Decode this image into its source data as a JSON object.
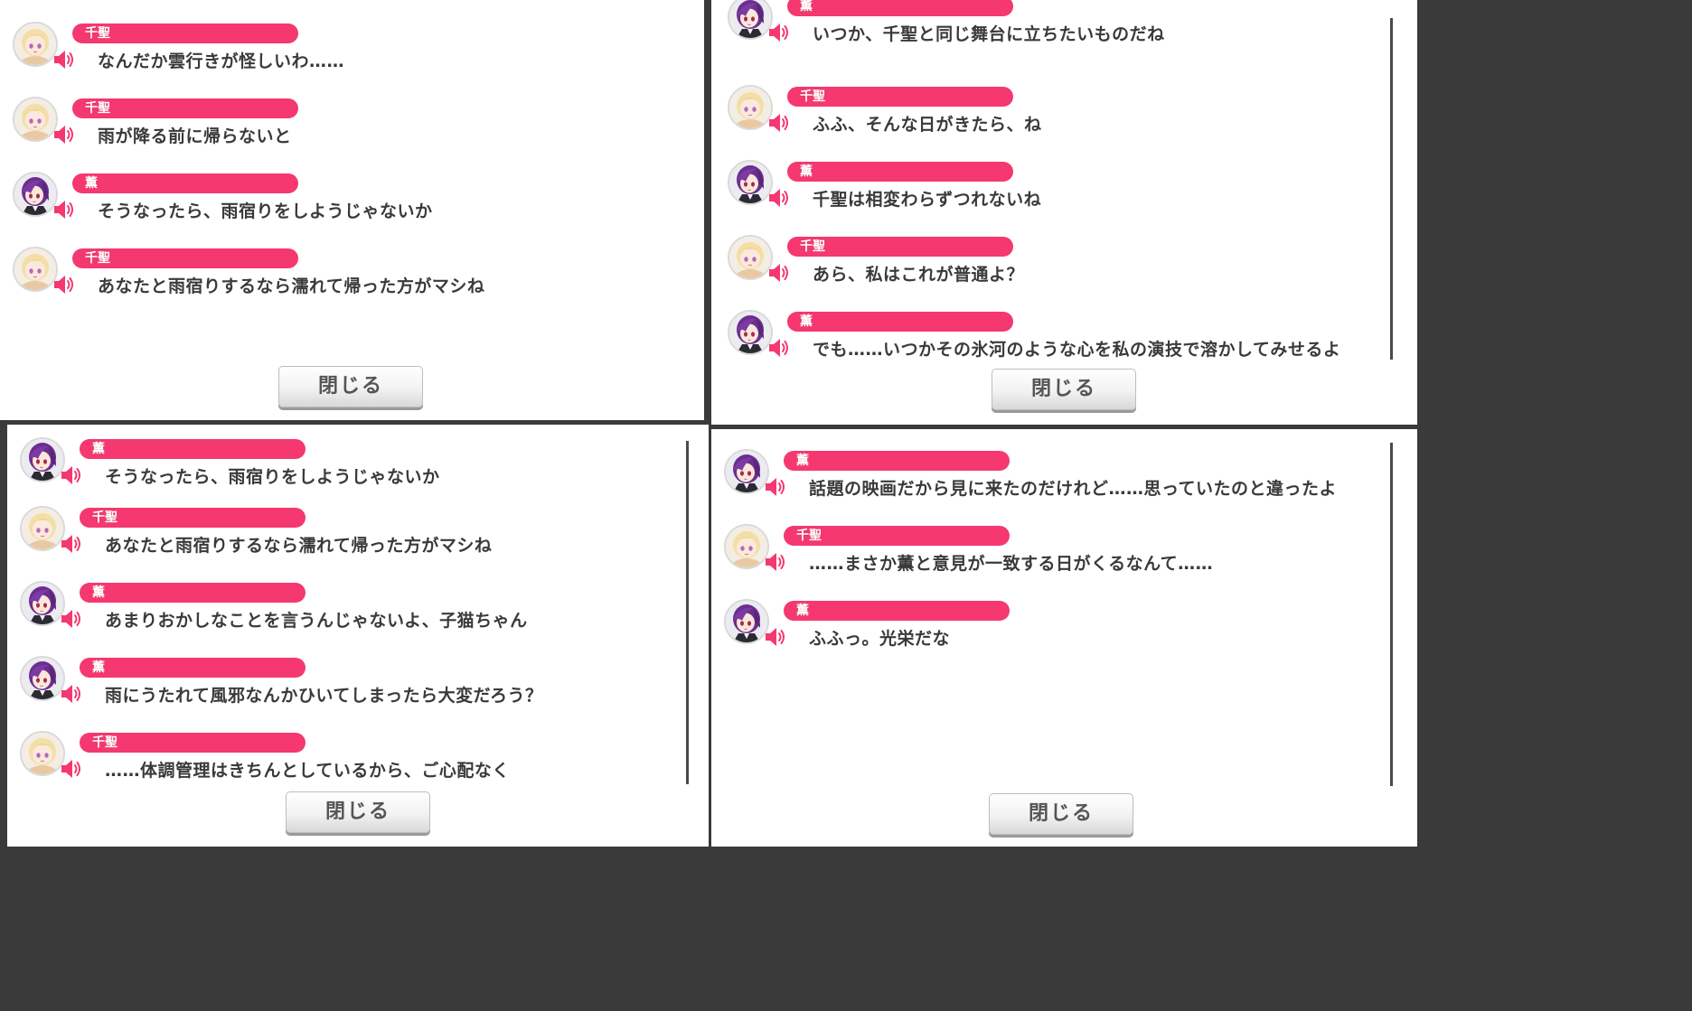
{
  "close_label": "閉じる",
  "colors": {
    "nameplate": "#f5386f",
    "speaker": "#f5386f"
  },
  "icons": {
    "speaker": "speaker-icon",
    "avatar_chisato": "chisato-avatar",
    "avatar_kaoru": "kaoru-avatar"
  },
  "panels": [
    {
      "entries": [
        {
          "name": "千聖",
          "text": "なんだか雲行きが怪しいわ……"
        },
        {
          "name": "千聖",
          "text": "雨が降る前に帰らないと"
        },
        {
          "name": "薫",
          "text": "そうなったら、雨宿りをしようじゃないか"
        },
        {
          "name": "千聖",
          "text": "あなたと雨宿りするなら濡れて帰った方がマシね"
        }
      ]
    },
    {
      "entries": [
        {
          "name": "薫",
          "text": "いつか、千聖と同じ舞台に立ちたいものだね"
        },
        {
          "name": "千聖",
          "text": "ふふ、そんな日がきたら、ね"
        },
        {
          "name": "薫",
          "text": "千聖は相変わらずつれないね"
        },
        {
          "name": "千聖",
          "text": "あら、私はこれが普通よ？"
        },
        {
          "name": "薫",
          "text": "でも……いつかその氷河のような心を私の演技で溶かしてみせるよ"
        }
      ]
    },
    {
      "entries": [
        {
          "name": "薫",
          "text": "そうなったら、雨宿りをしようじゃないか"
        },
        {
          "name": "千聖",
          "text": "あなたと雨宿りするなら濡れて帰った方がマシね"
        },
        {
          "name": "薫",
          "text": "あまりおかしなことを言うんじゃないよ、子猫ちゃん"
        },
        {
          "name": "薫",
          "text": "雨にうたれて風邪なんかひいてしまったら大変だろう？"
        },
        {
          "name": "千聖",
          "text": "……体調管理はきちんとしているから、ご心配なく"
        }
      ]
    },
    {
      "entries": [
        {
          "name": "薫",
          "text": "話題の映画だから見に来たのだけれど……思っていたのと違ったよ"
        },
        {
          "name": "千聖",
          "text": "……まさか薫と意見が一致する日がくるなんて……"
        },
        {
          "name": "薫",
          "text": "ふふっ。光栄だな"
        }
      ]
    }
  ]
}
